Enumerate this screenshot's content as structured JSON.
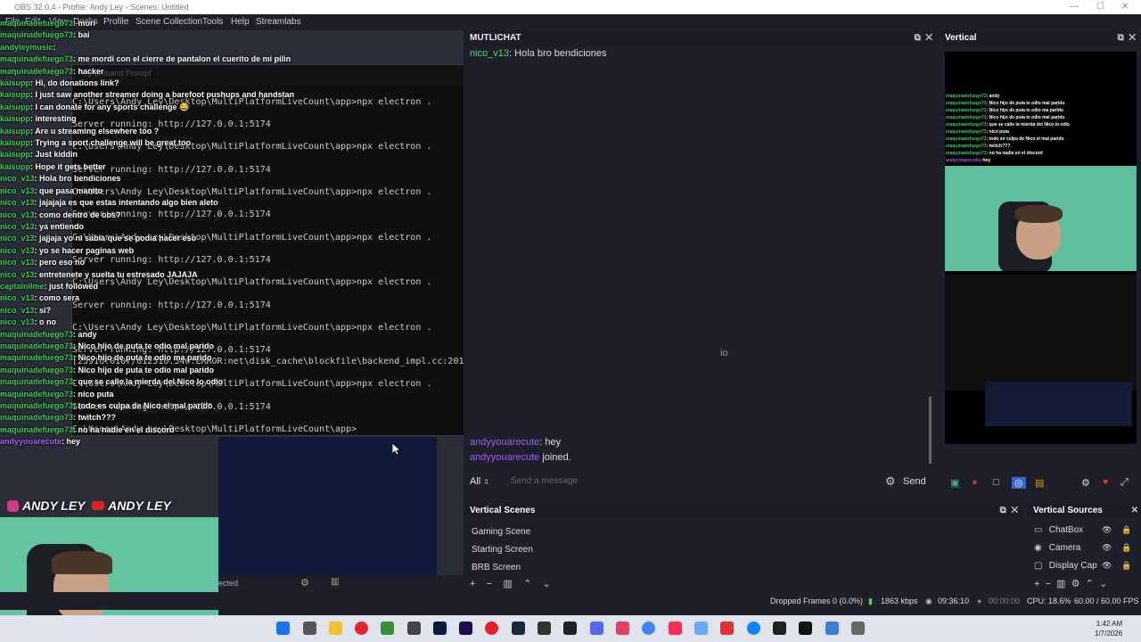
{
  "window": {
    "title": "OBS 32.0.4 - Profile: Andy Ley - Scenes: Untitled"
  },
  "menu": [
    "File",
    "Edit",
    "View",
    "Docks",
    "Profile",
    "Scene Collection",
    "Tools",
    "Help",
    "Streamlabs"
  ],
  "overlay_chat": [
    {
      "user": "maquinadefuego73",
      "msg": "mori"
    },
    {
      "user": "maquinadefuego73",
      "msg": "bai"
    },
    {
      "user": "andyleymusic",
      "msg": ""
    },
    {
      "user": "maquinadefuego73",
      "msg": "me mordi con el cierre de pantalon el cuerito de mi pilin"
    },
    {
      "user": "maquinadefuego73",
      "msg": "hacker"
    },
    {
      "user": "kaisupp",
      "msg": "Hi, do donations link?"
    },
    {
      "user": "kaisupp",
      "msg": "I just saw another streamer doing a barefoot pushups and handstands challenge and it was funny"
    },
    {
      "user": "kaisupp",
      "msg": "I can donate for any sports challenge 😂"
    },
    {
      "user": "kaisupp",
      "msg": "interesting"
    },
    {
      "user": "kaisupp",
      "msg": "Are u streaming elsewhere too ?"
    },
    {
      "user": "kaisupp",
      "msg": "Trying a sport challenge will be great too"
    },
    {
      "user": "kaisupp",
      "msg": "Just kiddin"
    },
    {
      "user": "kaisupp",
      "msg": "Hope it gets better"
    },
    {
      "user": "nico_v13",
      "msg": "Hola bro bendiciones"
    },
    {
      "user": "nico_v13",
      "msg": "que pasa manito"
    },
    {
      "user": "nico_v13",
      "msg": "jajajaja es que estas intentando algo bien aleto"
    },
    {
      "user": "nico_v13",
      "msg": "como dentro de obs?"
    },
    {
      "user": "nico_v13",
      "msg": "ya entiendo"
    },
    {
      "user": "nico_v13",
      "msg": "jajjaja yo ni sabia que se podia hacer eso"
    },
    {
      "user": "nico_v13",
      "msg": "yo se hacer paginas web"
    },
    {
      "user": "nico_v13",
      "msg": "pero eso no"
    },
    {
      "user": "nico_v13",
      "msg": "entretenete y suelta tu estresado JAJAJA"
    },
    {
      "user": "captainlime",
      "msg": "just followed"
    },
    {
      "user": "nico_v13",
      "msg": "como sera"
    },
    {
      "user": "nico_v13",
      "msg": "si?"
    },
    {
      "user": "nico_v13",
      "msg": "o no"
    },
    {
      "user": "maquinadefuego73",
      "msg": "andy"
    },
    {
      "user": "maquinadefuego73",
      "msg": "Nico hijo de puta te odio mal parido"
    },
    {
      "user": "maquinadefuego73",
      "msg": "Nico hijo de puta te odio ma parido"
    },
    {
      "user": "maquinadefuego73",
      "msg": "Nico hijo de puta te odio mal parido"
    },
    {
      "user": "maquinadefuego73",
      "msg": "que se calle la mierda del Nico lo odio"
    },
    {
      "user": "maquinadefuego73",
      "msg": "nico puta"
    },
    {
      "user": "maquinadefuego73",
      "msg": "todo es culpa de Nico el mal parido"
    },
    {
      "user": "maquinadefuego73",
      "msg": "twitch???"
    },
    {
      "user": "maquinadefuego73",
      "msg": "no ha nadie en el discord"
    },
    {
      "user": "andyyouarecute",
      "msg": "hey"
    }
  ],
  "banner": {
    "instagram": "ANDY LEY",
    "youtube": "ANDY LEY"
  },
  "terminal": {
    "tab": "Command Prompt",
    "prompt": "C:\\Users\\Andy Ley\\Desktop\\MultiPlatformLiveCount\\app>",
    "lines": [
      "C:\\Users\\Andy Ley\\Desktop\\MultiPlatformLiveCount\\app>npx electron .",
      "Server running: http://127.0.0.1:5174",
      "C:\\Users\\Andy Ley\\Desktop\\MultiPlatformLiveCount\\app>npx electron .",
      "Server running: http://127.0.0.1:5174",
      "C:\\Users\\Andy Ley\\Desktop\\MultiPlatformLiveCount\\app>npx electron .",
      "Server running: http://127.0.0.1:5174",
      "C:\\Users\\Andy Ley\\Desktop\\MultiPlatformLiveCount\\app>npx electron .",
      "Server running: http://127.0.0.1:5174",
      "C:\\Users\\Andy Ley\\Desktop\\MultiPlatformLiveCount\\app>npx electron .",
      "Server running: http://127.0.0.1:5174",
      "C:\\Users\\Andy Ley\\Desktop\\MultiPlatformLiveCount\\app>npx electron .",
      "Server running: http://127.0.0.1:5174",
      "[25916:0107/012510.546:ERROR:net\\disk_cache\\blockfile\\backend_impl.cc:2013] Invalid cache (current) size",
      "C:\\Users\\Andy Ley\\Desktop\\MultiPlatformLiveCount\\app>npx electron .",
      "Server running: http://127.0.0.1:5174",
      "C:\\Users\\Andy Ley\\Desktop\\MultiPlatformLiveCount\\app>"
    ]
  },
  "mutichat": {
    "title": "MUTLICHAT",
    "messages": [
      {
        "user": "nico_v13",
        "msg": "Hola bro bendiciones"
      },
      {
        "user": "andyyouarecute",
        "msg": "hey"
      },
      {
        "user": "andyyouarecute",
        "msg": "joined."
      }
    ],
    "filter": "All",
    "placeholder": "Send a message",
    "send_label": "Send"
  },
  "vertical": {
    "title": "Vertical",
    "mini_chat": [
      {
        "user": "maquinadefuego73",
        "msg": "andy"
      },
      {
        "user": "maquinadefuego73",
        "msg": "Nico hijo de puta te odio mal parido"
      },
      {
        "user": "maquinadefuego73",
        "msg": "Nico hijo de puta te odio ma parido"
      },
      {
        "user": "maquinadefuego73",
        "msg": "Nico hijo de puta te odio mal parido"
      },
      {
        "user": "maquinadefuego73",
        "msg": "que se calle la mierda del Nico lo odio"
      },
      {
        "user": "maquinadefuego73",
        "msg": "nico puta"
      },
      {
        "user": "maquinadefuego73",
        "msg": "todo es culpa de Nico el mal parido"
      },
      {
        "user": "maquinadefuego73",
        "msg": "twitch???"
      },
      {
        "user": "maquinadefuego73",
        "msg": "no ha nadie en el discord"
      },
      {
        "user": "andyyouarecute",
        "msg": "hey"
      }
    ]
  },
  "vertical_scenes": {
    "title": "Vertical Scenes",
    "items": [
      "Gaming Scene",
      "Starting Screen",
      "BRB Screen"
    ]
  },
  "vertical_sources": {
    "title": "Vertical Sources",
    "items": [
      {
        "name": "ChatBox",
        "icon": "chat-icon"
      },
      {
        "name": "Camera",
        "icon": "camera-icon"
      },
      {
        "name": "Display Cap",
        "icon": "display-icon"
      }
    ]
  },
  "statusbar": {
    "left_text": "ected",
    "dropped_frames": "Dropped Frames 0 (0.0%)",
    "kbps": "1863 kbps",
    "live_time": "09:36:10",
    "rec_time": "00:00:00",
    "cpu": "CPU: 18.6%",
    "fps": "60.00 / 60.00 FPS"
  },
  "taskbar": {
    "time": "1:42 AM",
    "date": "1/7/2026"
  },
  "colors": {
    "accent_green": "#34d058",
    "purple_user": "#a15cff",
    "dock_bg": "#1e1f29"
  }
}
